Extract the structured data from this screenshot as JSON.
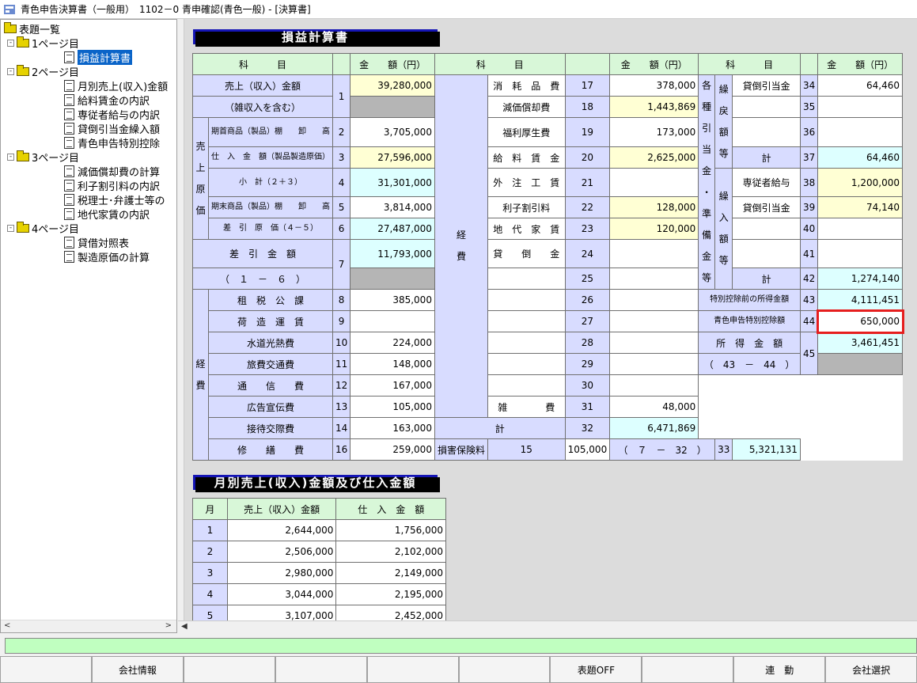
{
  "window": {
    "title": "青色申告決算書（一般用）　1102－0 青申確認(青色一般) - [決算書]"
  },
  "tree": {
    "root": "表題一覧",
    "pages": [
      {
        "label": "1ページ目",
        "items": [
          "損益計算書"
        ]
      },
      {
        "label": "2ページ目",
        "items": [
          "月別売上(収入)金額",
          "給料賃金の内訳",
          "専従者給与の内訳",
          "貸倒引当金繰入額",
          "青色申告特別控除"
        ]
      },
      {
        "label": "3ページ目",
        "items": [
          "減価償却費の計算",
          "利子割引料の内訳",
          "税理士･弁護士等の",
          "地代家賃の内訳"
        ]
      },
      {
        "label": "4ページ目",
        "items": [
          "貸借対照表",
          "製造原価の計算"
        ]
      }
    ]
  },
  "pl": {
    "title": "損益計算書",
    "h_kamoku": "科　　　目",
    "h_kingaku": "金　　額（円）",
    "sales_label": "売上（収入）金額",
    "sales_sub": "（雑収入を含む）",
    "sales_no": "1",
    "sales_val": "39,280,000",
    "genka_v": [
      "売",
      "上",
      "原",
      "価"
    ],
    "kishu": "期首商品（製品）棚　　卸　　高",
    "kishu_no": "2",
    "kishu_val": "3,705,000",
    "shiire": "仕　入　金　額（製品製造原価）",
    "shiire_no": "3",
    "shiire_val": "27,596,000",
    "shokei": "小　計（２＋３）",
    "shokei_no": "4",
    "shokei_val": "31,301,000",
    "kimatsu": "期末商品（製品）棚　　卸　　高",
    "kimatsu_no": "5",
    "kimatsu_val": "3,814,000",
    "sashihiki_genka": "差　引　原　価（４－５）",
    "sashihiki_genka_no": "6",
    "sashihiki_genka_val": "27,487,000",
    "sagaku": "差　引　金　額",
    "sagaku_sub": "（　１　－　６　）",
    "sagaku_no": "7",
    "sagaku_val": "11,793,000",
    "keihi_v": [
      "経",
      "費"
    ],
    "expA": [
      {
        "l": "租　税　公　課",
        "n": "8",
        "v": "385,000"
      },
      {
        "l": "荷　造　運　賃",
        "n": "9",
        "v": ""
      },
      {
        "l": "水道光熱費",
        "n": "10",
        "v": "224,000"
      },
      {
        "l": "旅費交通費",
        "n": "11",
        "v": "148,000"
      },
      {
        "l": "通　　信　　費",
        "n": "12",
        "v": "167,000"
      },
      {
        "l": "広告宣伝費",
        "n": "13",
        "v": "105,000"
      },
      {
        "l": "接待交際費",
        "n": "14",
        "v": "163,000"
      },
      {
        "l": "損害保険料",
        "n": "15",
        "v": "105,000"
      },
      {
        "l": "修　　繕　　費",
        "n": "16",
        "v": "259,000"
      }
    ],
    "expB": [
      {
        "l": "消　耗　品　費",
        "n": "17",
        "v": "378,000"
      },
      {
        "l": "減価償却費",
        "n": "18",
        "v": "1,443,869"
      },
      {
        "l": "福利厚生費",
        "n": "19",
        "v": "173,000"
      },
      {
        "l": "給　料　賃　金",
        "n": "20",
        "v": "2,625,000"
      },
      {
        "l": "外　注　工　賃",
        "n": "21",
        "v": ""
      },
      {
        "l": "利子割引料",
        "n": "22",
        "v": "128,000"
      },
      {
        "l": "地　代　家　賃",
        "n": "23",
        "v": "120,000"
      },
      {
        "l": "貸　　倒　　金",
        "n": "24",
        "v": ""
      },
      {
        "l": "",
        "n": "25",
        "v": ""
      },
      {
        "l": "",
        "n": "26",
        "v": ""
      },
      {
        "l": "",
        "n": "27",
        "v": ""
      },
      {
        "l": "",
        "n": "28",
        "v": ""
      },
      {
        "l": "",
        "n": "29",
        "v": ""
      },
      {
        "l": "",
        "n": "30",
        "v": ""
      },
      {
        "l": "雑　　　　費",
        "n": "31",
        "v": "48,000"
      },
      {
        "l": "計",
        "n": "32",
        "v": "6,471,869"
      }
    ],
    "sashihiki2": "差　引　金　額",
    "sashihiki2_sub": "（　７　－　32　）",
    "sashihiki2_no": "33",
    "sashihiki2_val": "5,321,131",
    "kuri_v1": [
      "繰",
      "戻",
      "額",
      "等"
    ],
    "kuri_v2": [
      "各",
      "種",
      "引",
      "当",
      "金",
      "・",
      "準",
      "備",
      "金",
      "等"
    ],
    "kuri_v3": [
      "繰",
      "入",
      "額",
      "等"
    ],
    "colC": [
      {
        "l": "貸倒引当金",
        "n": "34",
        "v": "64,460"
      },
      {
        "l": "",
        "n": "35",
        "v": ""
      },
      {
        "l": "",
        "n": "36",
        "v": ""
      },
      {
        "l": "計",
        "n": "37",
        "v": "64,460"
      },
      {
        "l": "専従者給与",
        "n": "38",
        "v": "1,200,000"
      },
      {
        "l": "貸倒引当金",
        "n": "39",
        "v": "74,140"
      },
      {
        "l": "",
        "n": "40",
        "v": ""
      },
      {
        "l": "",
        "n": "41",
        "v": ""
      },
      {
        "l": "計",
        "n": "42",
        "v": "1,274,140"
      }
    ],
    "tokubetsu_mae": "特別控除前の所得金額",
    "tokubetsu_mae_no": "43",
    "tokubetsu_mae_val": "4,111,451",
    "aoiro": "青色申告特別控除額",
    "aoiro_no": "44",
    "aoiro_val": "650,000",
    "shotoku": "所　得　金　額",
    "shotoku_sub": "（　43　－　44　）",
    "shotoku_no": "45",
    "shotoku_val": "3,461,451"
  },
  "monthly": {
    "title": "月別売上(収入)金額及び仕入金額",
    "h_month": "月",
    "h_sales": "売上（収入）金額",
    "h_purchase": "仕　入　金　額",
    "rows": [
      {
        "m": "1",
        "s": "2,644,000",
        "p": "1,756,000"
      },
      {
        "m": "2",
        "s": "2,506,000",
        "p": "2,102,000"
      },
      {
        "m": "3",
        "s": "2,980,000",
        "p": "2,149,000"
      },
      {
        "m": "4",
        "s": "3,044,000",
        "p": "2,195,000"
      },
      {
        "m": "5",
        "s": "3,107,000",
        "p": "2,452,000"
      }
    ]
  },
  "fkeys": [
    "",
    "会社情報",
    "",
    "",
    "",
    "",
    "表題OFF",
    "",
    "連　動",
    "会社選択"
  ]
}
